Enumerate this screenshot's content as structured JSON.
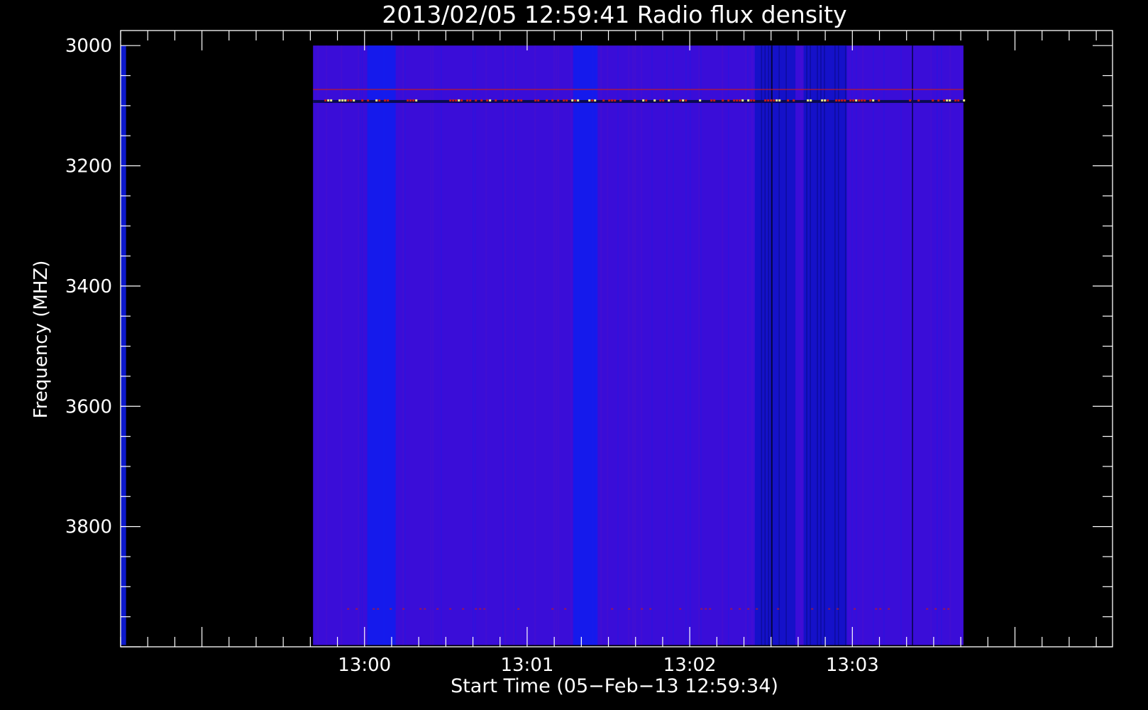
{
  "chart_data": {
    "type": "heatmap",
    "title": "2013/02/05 12:59:41 Radio flux density",
    "xlabel": "Start Time (05−Feb−13 12:59:34)",
    "ylabel": "Frequency (MHZ)",
    "x_range_seconds_from_1300": [
      -90,
      276
    ],
    "ylim": [
      4000,
      2975
    ],
    "y_ticks": [
      3000,
      3200,
      3400,
      3600,
      3800
    ],
    "y_tick_labels": [
      "3000",
      "3200",
      "3400",
      "3600",
      "3800"
    ],
    "x_ticks": [
      "13:00",
      "13:01",
      "13:02",
      "13:03"
    ],
    "x_tick_labels": [
      "13:00",
      "13:01",
      "13:02",
      "13:03"
    ],
    "data_extent": {
      "t_start": "12:59:41",
      "t_end": "13:03:41",
      "f_min": 3000,
      "f_max": 3997
    },
    "colors": {
      "background": "#000000",
      "base": "#3a0dd8",
      "bright_blue": "#0f1df0",
      "dark_blue": "#0a0a8a",
      "red": "#c81a1a",
      "yellow": "#f8f08a"
    },
    "bright_bands_seconds": [
      [
        77,
        86
      ],
      [
        1,
        11.5
      ],
      [
        -90,
        -88
      ]
    ],
    "dark_bands_seconds": [
      [
        144,
        159
      ],
      [
        162,
        178
      ]
    ],
    "rfi_lines_mhz": [
      3073,
      3093,
      3937
    ]
  }
}
